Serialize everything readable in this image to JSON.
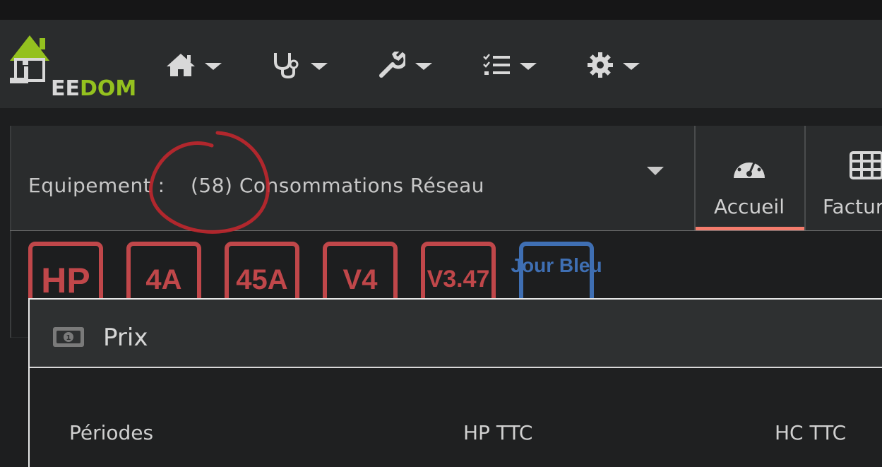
{
  "logo": {
    "brand_prefix": "EE",
    "brand_suffix": "DOM"
  },
  "nav": [
    {
      "icon": "home-icon"
    },
    {
      "icon": "stethoscope-icon"
    },
    {
      "icon": "wrench-icon"
    },
    {
      "icon": "tasks-icon"
    },
    {
      "icon": "gear-icon"
    }
  ],
  "equipment": {
    "label": "Equipement :",
    "value": "(58) Consommations Réseau"
  },
  "tabs": [
    {
      "label": "Accueil",
      "icon": "dashboard-icon",
      "active": true
    },
    {
      "label": "Factur",
      "icon": "table-icon",
      "active": false
    }
  ],
  "badges": [
    {
      "text": "HP",
      "color": "#c0474a"
    },
    {
      "text": "4A",
      "color": "#c0474a"
    },
    {
      "text": "45A",
      "color": "#c0474a"
    },
    {
      "text": "V4",
      "color": "#c0474a"
    },
    {
      "text": "V3.47",
      "color": "#c0474a"
    },
    {
      "text": "Jour Bleu",
      "color": "#3f6fb3"
    }
  ],
  "modal": {
    "title": "Prix",
    "icon": "money-bill-icon",
    "columns": [
      "Périodes",
      "HP TTC",
      "HC TTC"
    ]
  },
  "colors": {
    "accent_underline": "#f47c6c",
    "brand_green": "#94c11f",
    "annotation_red": "#c0272d"
  }
}
